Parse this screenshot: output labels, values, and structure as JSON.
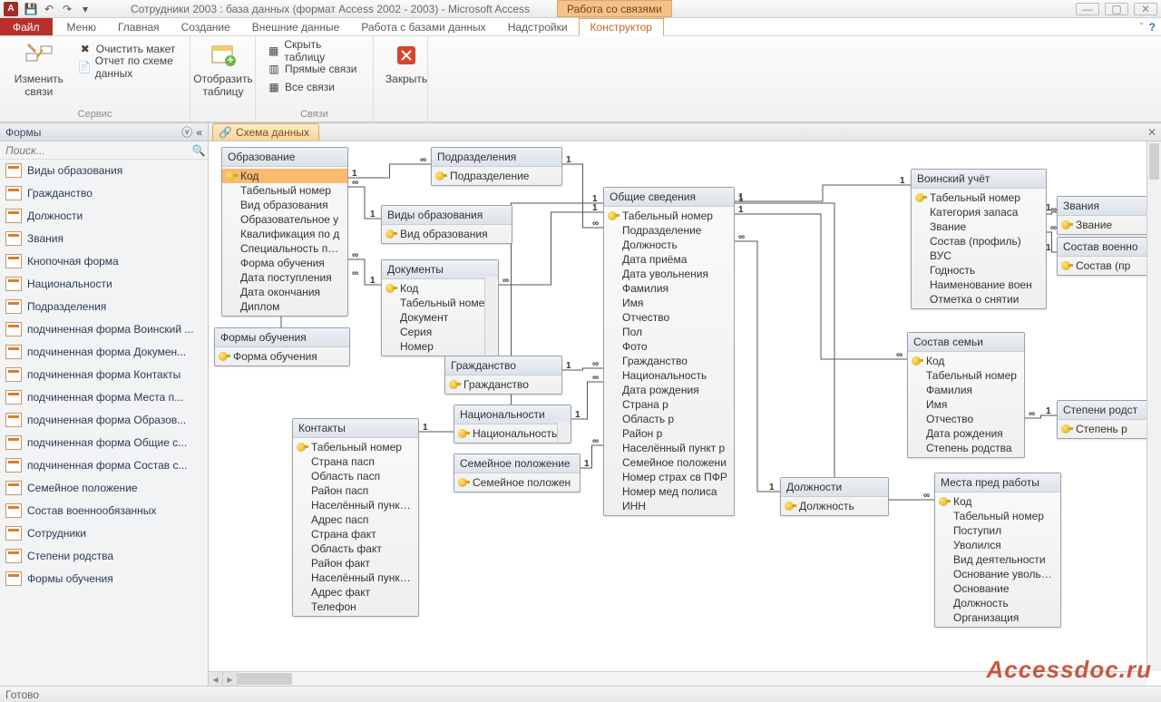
{
  "titlebar": {
    "app_initial": "A",
    "title": "Сотрудники 2003 : база данных (формат Access 2002 - 2003)  -  Microsoft Access",
    "tool_tab": "Работа со связями"
  },
  "menubar": {
    "file": "Файл",
    "tabs": [
      "Меню",
      "Главная",
      "Создание",
      "Внешние данные",
      "Работа с базами данных",
      "Надстройки"
    ],
    "active_tab": "Конструктор"
  },
  "ribbon": {
    "group1": {
      "label": "Сервис",
      "edit_rel": "Изменить связи",
      "clear": "Очистить макет",
      "report": "Отчет по схеме данных"
    },
    "group2": {
      "label": "",
      "show_table": "Отобразить таблицу"
    },
    "group3": {
      "label": "Связи",
      "hide_table": "Скрыть таблицу",
      "direct": "Прямые связи",
      "all": "Все связи"
    },
    "group4": {
      "label": "",
      "close": "Закрыть"
    }
  },
  "nav": {
    "header": "Формы",
    "search_placeholder": "Поиск...",
    "items": [
      "Виды образования",
      "Гражданство",
      "Должности",
      "Звания",
      "Кнопочная форма",
      "Национальности",
      "Подразделения",
      "подчиненная форма Воинский ...",
      "подчиненная форма Докумен...",
      "подчиненная форма Контакты",
      "подчиненная форма Места п...",
      "подчиненная форма Образов...",
      "подчиненная форма Общие с...",
      "подчиненная форма Состав с...",
      "Семейное положение",
      "Состав военнообязанных",
      "Сотрудники",
      "Степени родства",
      "Формы обучения"
    ]
  },
  "doc_tab": "Схема данных",
  "status": "Готово",
  "watermark": "Accessdoc.ru",
  "tables": {
    "obrazovanie": {
      "title": "Образование",
      "key": [
        "Код"
      ],
      "selected": "Код",
      "fields": [
        "Табельный номер",
        "Вид образования",
        "Образовательное у",
        "Квалификация по д",
        "Специальность по д",
        "Форма обучения",
        "Дата поступления",
        "Дата окончания",
        "Диплом"
      ]
    },
    "podrazdeleniya": {
      "title": "Подразделения",
      "key": [
        "Подразделение"
      ],
      "fields": []
    },
    "vidy_obr": {
      "title": "Виды образования",
      "key": [
        "Вид образования"
      ],
      "fields": []
    },
    "dokumenty": {
      "title": "Документы",
      "key": [
        "Код"
      ],
      "fields": [
        "Табельный номе",
        "Документ",
        "Серия",
        "Номер"
      ],
      "scrollbar": true
    },
    "formy_obuch": {
      "title": "Формы обучения",
      "key": [
        "Форма обучения"
      ],
      "fields": []
    },
    "grazhdanstvo": {
      "title": "Гражданство",
      "key": [
        "Гражданство"
      ],
      "fields": []
    },
    "nacionalnosti": {
      "title": "Национальности",
      "key": [
        "Национальность"
      ],
      "fields": [],
      "scrollbar": true
    },
    "kontakty": {
      "title": "Контакты",
      "key": [
        "Табельный номер"
      ],
      "fields": [
        "Страна пасп",
        "Область пасп",
        "Район пасп",
        "Населённый пункт п",
        "Адрес пасп",
        "Страна факт",
        "Область факт",
        "Район факт",
        "Населённый пункт ф",
        "Адрес факт",
        "Телефон"
      ]
    },
    "semeynoe": {
      "title": "Семейное положение",
      "key": [
        "Семейное положен"
      ],
      "fields": []
    },
    "obschie": {
      "title": "Общие сведения",
      "key": [
        "Табельный номер"
      ],
      "fields": [
        "Подразделение",
        "Должность",
        "Дата приёма",
        "Дата увольнения",
        "Фамилия",
        "Имя",
        "Отчество",
        "Пол",
        "Фото",
        "Гражданство",
        "Национальность",
        "Дата рождения",
        "Страна р",
        "Область р",
        "Район р",
        "Населённый пункт р",
        "Семейное положени",
        "Номер страх св ПФР",
        "Номер мед полиса",
        "ИНН"
      ]
    },
    "dolzhnosti": {
      "title": "Должности",
      "key": [
        "Должность"
      ],
      "fields": []
    },
    "voinskiy": {
      "title": "Воинский учёт",
      "key": [
        "Табельный номер"
      ],
      "fields": [
        "Категория запаса",
        "Звание",
        "Состав (профиль)",
        "ВУС",
        "Годность",
        "Наименование воен",
        "Отметка о снятии"
      ]
    },
    "zvaniya": {
      "title": "Звания",
      "key": [
        "Звание"
      ],
      "fields": []
    },
    "sostav_voen": {
      "title": "Состав военно",
      "key": [
        "Состав (пр"
      ],
      "fields": []
    },
    "sostav_semi": {
      "title": "Состав семьи",
      "key": [
        "Код"
      ],
      "fields": [
        "Табельный номер",
        "Фамилия",
        "Имя",
        "Отчество",
        "Дата рождения",
        "Степень родства"
      ]
    },
    "stepeni": {
      "title": "Степени родст",
      "key": [
        "Степень р"
      ],
      "fields": []
    },
    "mesta_pred": {
      "title": "Места пред работы",
      "key": [
        "Код"
      ],
      "fields": [
        "Табельный номер",
        "Поступил",
        "Уволился",
        "Вид деятельности",
        "Основание увольнен",
        "Основание",
        "Должность",
        "Организация"
      ]
    }
  }
}
